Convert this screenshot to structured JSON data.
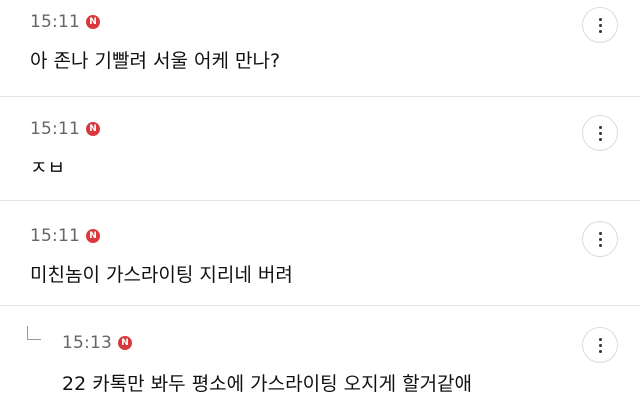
{
  "comments": [
    {
      "time": "15:11",
      "badge": "N",
      "text": "아 존나 기빨려 서울 어케 만나?"
    },
    {
      "time": "15:11",
      "badge": "N",
      "text": "ㅈㅂ"
    },
    {
      "time": "15:11",
      "badge": "N",
      "text": "미친놈이 가스라이팅 지리네 버려"
    },
    {
      "time": "15:13",
      "badge": "N",
      "text": "22 카톡만 봐두 평소에 가스라이팅 오지게 할거같애",
      "is_reply": true
    }
  ],
  "more_icon": "more-vertical-icon",
  "colors": {
    "badge": "#d9383d",
    "separator": "#e4e4e4",
    "time": "#666666"
  }
}
